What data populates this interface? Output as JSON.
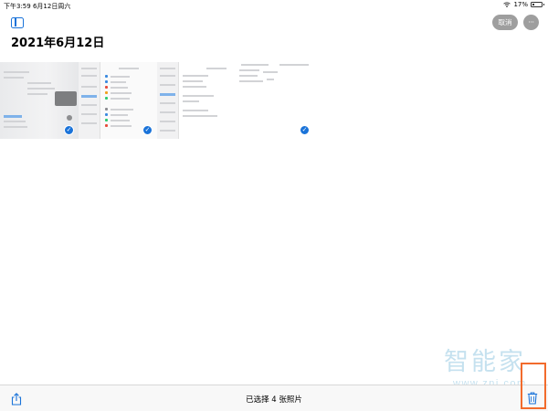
{
  "status_bar": {
    "time": "下午3:59",
    "date": "6月12日周六",
    "battery": "17%",
    "battery_level": 0.17
  },
  "header": {
    "title": "2021年6月12日",
    "cancel_label": "取消",
    "more_label": "···"
  },
  "photos": {
    "selected": [
      true,
      true,
      false,
      true
    ],
    "check_glyph": "✓"
  },
  "toolbar": {
    "selection_label": "已选择 4 张照片"
  },
  "watermark": {
    "chinese": "智能家",
    "url": "www.znj.com"
  },
  "colors": {
    "accent": "#1a73d9",
    "highlight": "#f26b2c",
    "pill": "#9e9e9e"
  },
  "icons": [
    "wifi-icon",
    "battery-icon",
    "sidebar-toggle-icon",
    "share-icon",
    "trash-icon",
    "checkmark-icon"
  ]
}
